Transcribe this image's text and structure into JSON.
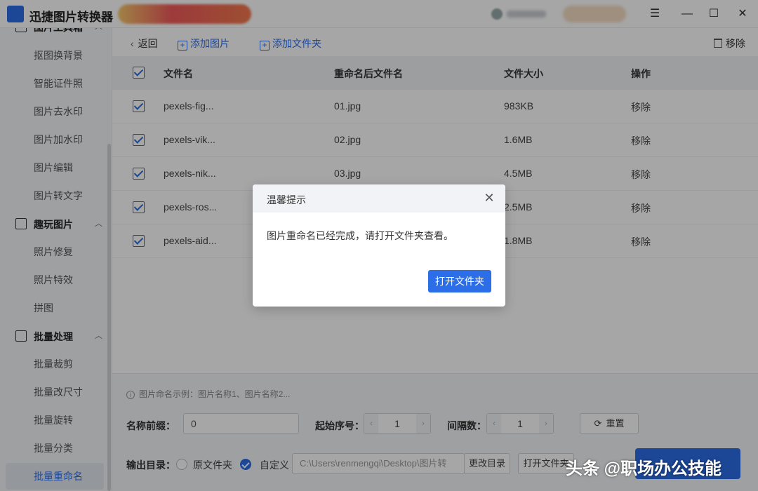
{
  "window": {
    "title": "迅捷图片转换器",
    "minimize_icon": "minimize-icon",
    "maximize_icon": "maximize-icon",
    "close_icon": "close-icon",
    "menu_icon": "menu-icon"
  },
  "sidebar": {
    "partial_section": "图片工具箱",
    "items_group1": [
      "抠图换背景",
      "智能证件照",
      "图片去水印",
      "图片加水印",
      "图片编辑",
      "图片转文字"
    ],
    "section2": "趣玩图片",
    "items_group2": [
      "照片修复",
      "照片特效",
      "拼图"
    ],
    "section3": "批量处理",
    "items_group3": [
      "批量裁剪",
      "批量改尺寸",
      "批量旋转",
      "批量分类",
      "批量重命名"
    ],
    "active_item": "批量重命名"
  },
  "toolbar": {
    "back": "返回",
    "add_image": "添加图片",
    "add_folder": "添加文件夹",
    "remove": "移除"
  },
  "table": {
    "headers": [
      "文件名",
      "重命名后文件名",
      "文件大小",
      "操作"
    ],
    "rows": [
      {
        "name": "pexels-fig...",
        "renamed": "01.jpg",
        "size": "983KB",
        "action": "移除"
      },
      {
        "name": "pexels-vik...",
        "renamed": "02.jpg",
        "size": "1.6MB",
        "action": "移除"
      },
      {
        "name": "pexels-nik...",
        "renamed": "03.jpg",
        "size": "4.5MB",
        "action": "移除"
      },
      {
        "name": "pexels-ros...",
        "renamed": "",
        "size": "2.5MB",
        "action": "移除"
      },
      {
        "name": "pexels-aid...",
        "renamed": "",
        "size": "1.8MB",
        "action": "移除"
      }
    ]
  },
  "settings": {
    "hint": "图片命名示例：图片名称1、图片名称2...",
    "prefix_label": "名称前缀：",
    "prefix_value": "0",
    "start_label": "起始序号：",
    "start_value": "1",
    "step_label": "间隔数：",
    "step_value": "1",
    "reset": "重置",
    "output_label": "输出目录：",
    "opt_original": "原文件夹",
    "opt_custom": "自定义",
    "path": "C:\\Users\\renmengqi\\Desktop\\图片转",
    "change_dir": "更改目录",
    "open_folder": "打开文件夹"
  },
  "dialog": {
    "title": "温馨提示",
    "message": "图片重命名已经完成，请打开文件夹查看。",
    "button": "打开文件夹"
  },
  "watermark": "头条 @职场办公技能"
}
